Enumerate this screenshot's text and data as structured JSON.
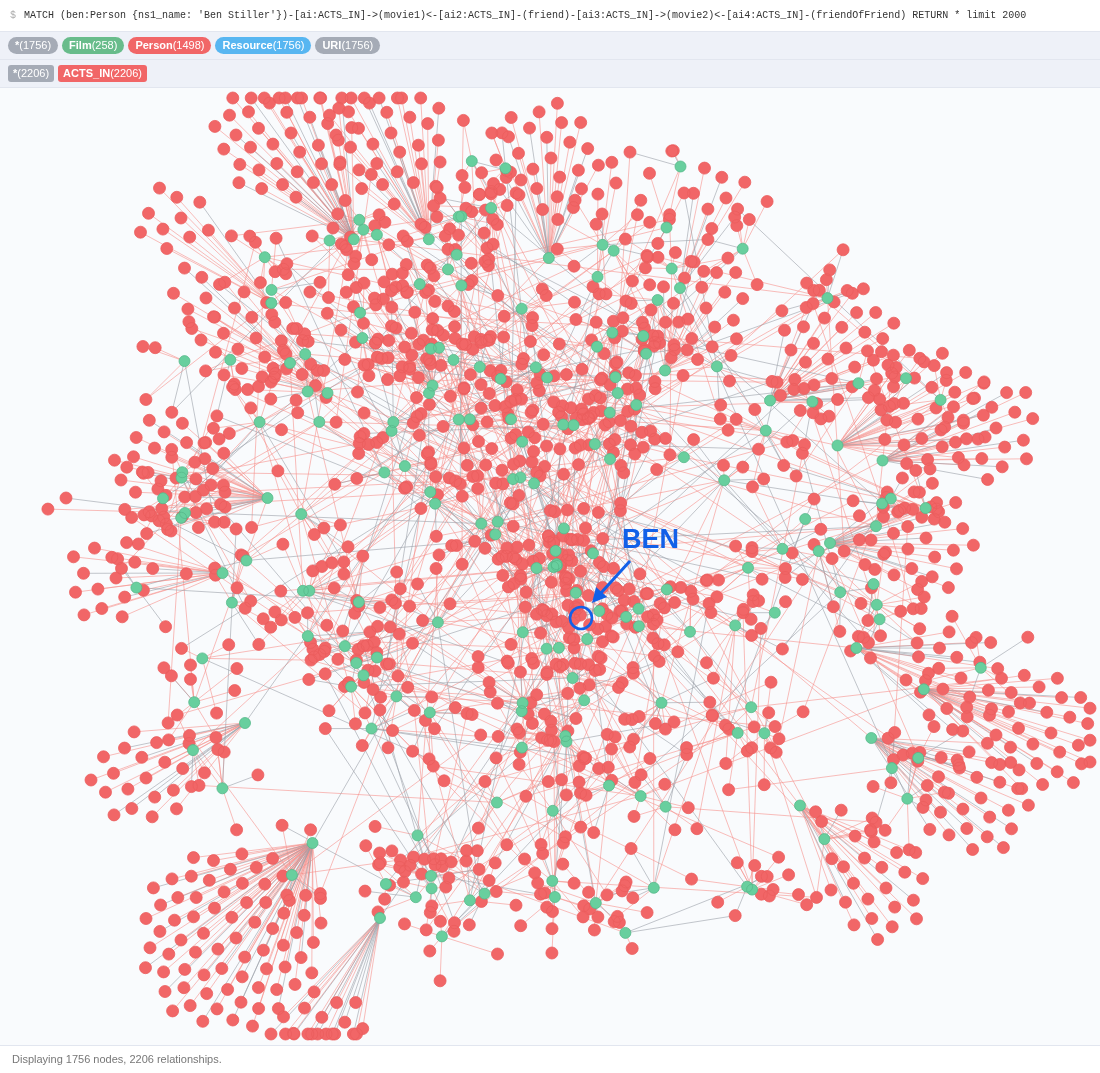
{
  "query": {
    "prompt": "$",
    "text": "MATCH (ben:Person {ns1_name: 'Ben Stiller'})-[ai:ACTS_IN]->(movie1)<-[ai2:ACTS_IN]-(friend)-[ai3:ACTS_IN]->(movie2)<-[ai4:ACTS_IN]-(friendOfFriend) RETURN * limit 2000"
  },
  "node_labels": [
    {
      "label": "*",
      "count": "(1756)",
      "color": "#a5abb6"
    },
    {
      "label": "Film",
      "count": "(258)",
      "color": "#68bc8b"
    },
    {
      "label": "Person",
      "count": "(1498)",
      "color": "#f16667"
    },
    {
      "label": "Resource",
      "count": "(1756)",
      "color": "#57b6f1"
    },
    {
      "label": "URI",
      "count": "(1756)",
      "color": "#a5abb6"
    }
  ],
  "relationship_types": [
    {
      "label": "*",
      "count": "(2206)",
      "color": "#a5abb6"
    },
    {
      "label": "ACTS_IN",
      "count": "(2206)",
      "color": "#f16667"
    }
  ],
  "annotation": {
    "text": "BEN"
  },
  "status": "Displaying 1756 nodes, 2206 relationships."
}
